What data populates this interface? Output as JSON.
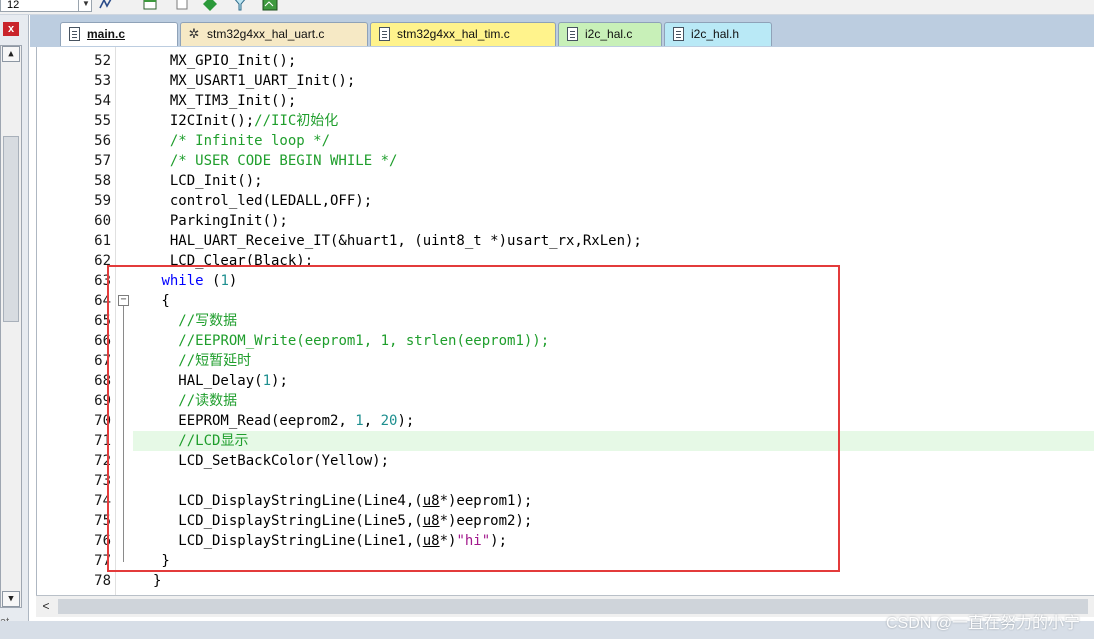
{
  "toolbar": {
    "combo_value": "12",
    "icons": [
      "dropdown-arrow-icon",
      "wave-icon",
      "window-icon",
      "window-copy-icon",
      "diamond-download-icon",
      "filter-icon",
      "image-icon"
    ]
  },
  "panel": {
    "close_label": "x",
    "status_text": "at..."
  },
  "tabs": [
    {
      "label": "main.c",
      "active": true,
      "bg": "#ffffff",
      "icon": "file-icon"
    },
    {
      "label": "stm32g4xx_hal_uart.c",
      "active": false,
      "bg": "#f6e9c5",
      "icon": "gear-file-icon"
    },
    {
      "label": "stm32g4xx_hal_tim.c",
      "active": false,
      "bg": "#fff38c",
      "icon": "file-icon"
    },
    {
      "label": "i2c_hal.c",
      "active": false,
      "bg": "#c8f0b8",
      "icon": "file-icon"
    },
    {
      "label": "i2c_hal.h",
      "active": false,
      "bg": "#b9e9f6",
      "icon": "file-icon"
    }
  ],
  "editor": {
    "current_line": "71",
    "lines": [
      {
        "n": "52",
        "t": "  MX_GPIO_Init();"
      },
      {
        "n": "53",
        "t": "  MX_USART1_UART_Init();"
      },
      {
        "n": "54",
        "t": "  MX_TIM3_Init();"
      },
      {
        "n": "55",
        "t": "  I2CInit();//IIC初始化"
      },
      {
        "n": "56",
        "t": "  /* Infinite loop */"
      },
      {
        "n": "57",
        "t": "  /* USER CODE BEGIN WHILE */"
      },
      {
        "n": "58",
        "t": "  LCD_Init();"
      },
      {
        "n": "59",
        "t": "  control_led(LEDALL,OFF);"
      },
      {
        "n": "60",
        "t": "  ParkingInit();"
      },
      {
        "n": "61",
        "t": "  HAL_UART_Receive_IT(&huart1, (uint8_t *)usart_rx,RxLen);"
      },
      {
        "n": "62",
        "t": "  LCD_Clear(Black);"
      },
      {
        "n": "63",
        "t": " while (1)"
      },
      {
        "n": "64",
        "t": " {"
      },
      {
        "n": "65",
        "t": "   //写数据"
      },
      {
        "n": "66",
        "t": "   //EEPROM_Write(eeprom1, 1, strlen(eeprom1));"
      },
      {
        "n": "67",
        "t": "   //短暂延时"
      },
      {
        "n": "68",
        "t": "   HAL_Delay(1);"
      },
      {
        "n": "69",
        "t": "   //读数据"
      },
      {
        "n": "70",
        "t": "   EEPROM_Read(eeprom2, 1, 20);"
      },
      {
        "n": "71",
        "t": "   //LCD显示"
      },
      {
        "n": "72",
        "t": "   LCD_SetBackColor(Yellow);"
      },
      {
        "n": "73",
        "t": ""
      },
      {
        "n": "74",
        "t": "   LCD_DisplayStringLine(Line4,(u8*)eeprom1);"
      },
      {
        "n": "75",
        "t": "   LCD_DisplayStringLine(Line5,(u8*)eeprom2);"
      },
      {
        "n": "76",
        "t": "   LCD_DisplayStringLine(Line1,(u8*)\"hi\");"
      },
      {
        "n": "77",
        "t": " }"
      },
      {
        "n": "78",
        "t": "}"
      }
    ]
  },
  "watermark": "CSDN @一直在努力的小宁",
  "colors": {
    "keyword": "#0000ff",
    "number": "#1e8f8f",
    "comment": "#1f9e2c",
    "string": "#a2188c",
    "annotation_box": "#e33b3b",
    "current_line_bg": "#e6f9e6"
  }
}
